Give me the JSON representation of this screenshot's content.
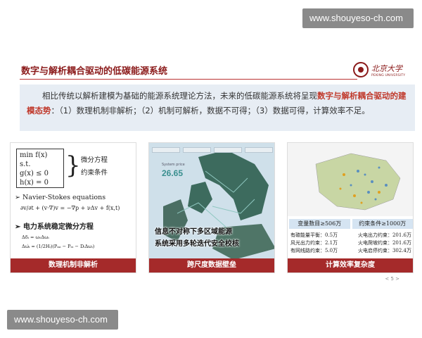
{
  "watermark": {
    "top": "www.shouyeso-ch.com",
    "bottom": "www.shouyeso-ch.com"
  },
  "slide": {
    "title": "数字与解析耦合驱动的低碳能源系统",
    "logo": {
      "cn": "北京大学",
      "en": "PEKING UNIVERSITY"
    },
    "intro": {
      "part1": "相比传统以解析建模为基础的能源系统理论方法，未来的低碳能源系统将呈现",
      "highlight": "数字与解析耦合驱动的建模态势",
      "part2": "：（1）数理机制非解析；（2）机制可解析，数据不可得；（3）数据可得，计算效率不足。"
    },
    "panels": [
      {
        "caption": "数理机制非解析",
        "opt_lines": [
          "min f(x)",
          "s.t.",
          "g(x) ≤ 0",
          "h(x) = 0"
        ],
        "opt_note": [
          "微分方程",
          "约束条件"
        ],
        "ns_label": "➢ Navier-Stokes equations",
        "ns_eq": "∂v/∂t + (v·∇)v = −∇p + νΔv + f(x,t)",
        "ps_label": "➢ 电力系统稳定微分方程",
        "ps_eq1": "Δδᵢ = ω₀Δωᵢ",
        "ps_eq2": "Δω̇ᵢ = (1/2Hᵢ)(Pₘᵢ − Pₑᵢ − DᵢΔωᵢ)"
      },
      {
        "caption": "跨尺度数据壁垒",
        "stat_label": "System price",
        "stat_value": "26.65",
        "overlay": [
          "信息不对称下多区域能源",
          "系统采用多轮迭代安全校核"
        ]
      },
      {
        "caption": "计算效率复杂度",
        "stats": [
          "变量数目≥506万",
          "约束条件≥1000万"
        ],
        "constraints": [
          [
            "有碳能量平衡：0.5万",
            "火电出力约束：201.6万"
          ],
          [
            "风光出力约束：2.1万",
            "火电爬坡约束：201.6万"
          ],
          [
            "有网线路约束：5.0万",
            "火电启停约束：302.4万"
          ]
        ]
      }
    ],
    "page": "< 5 >"
  }
}
